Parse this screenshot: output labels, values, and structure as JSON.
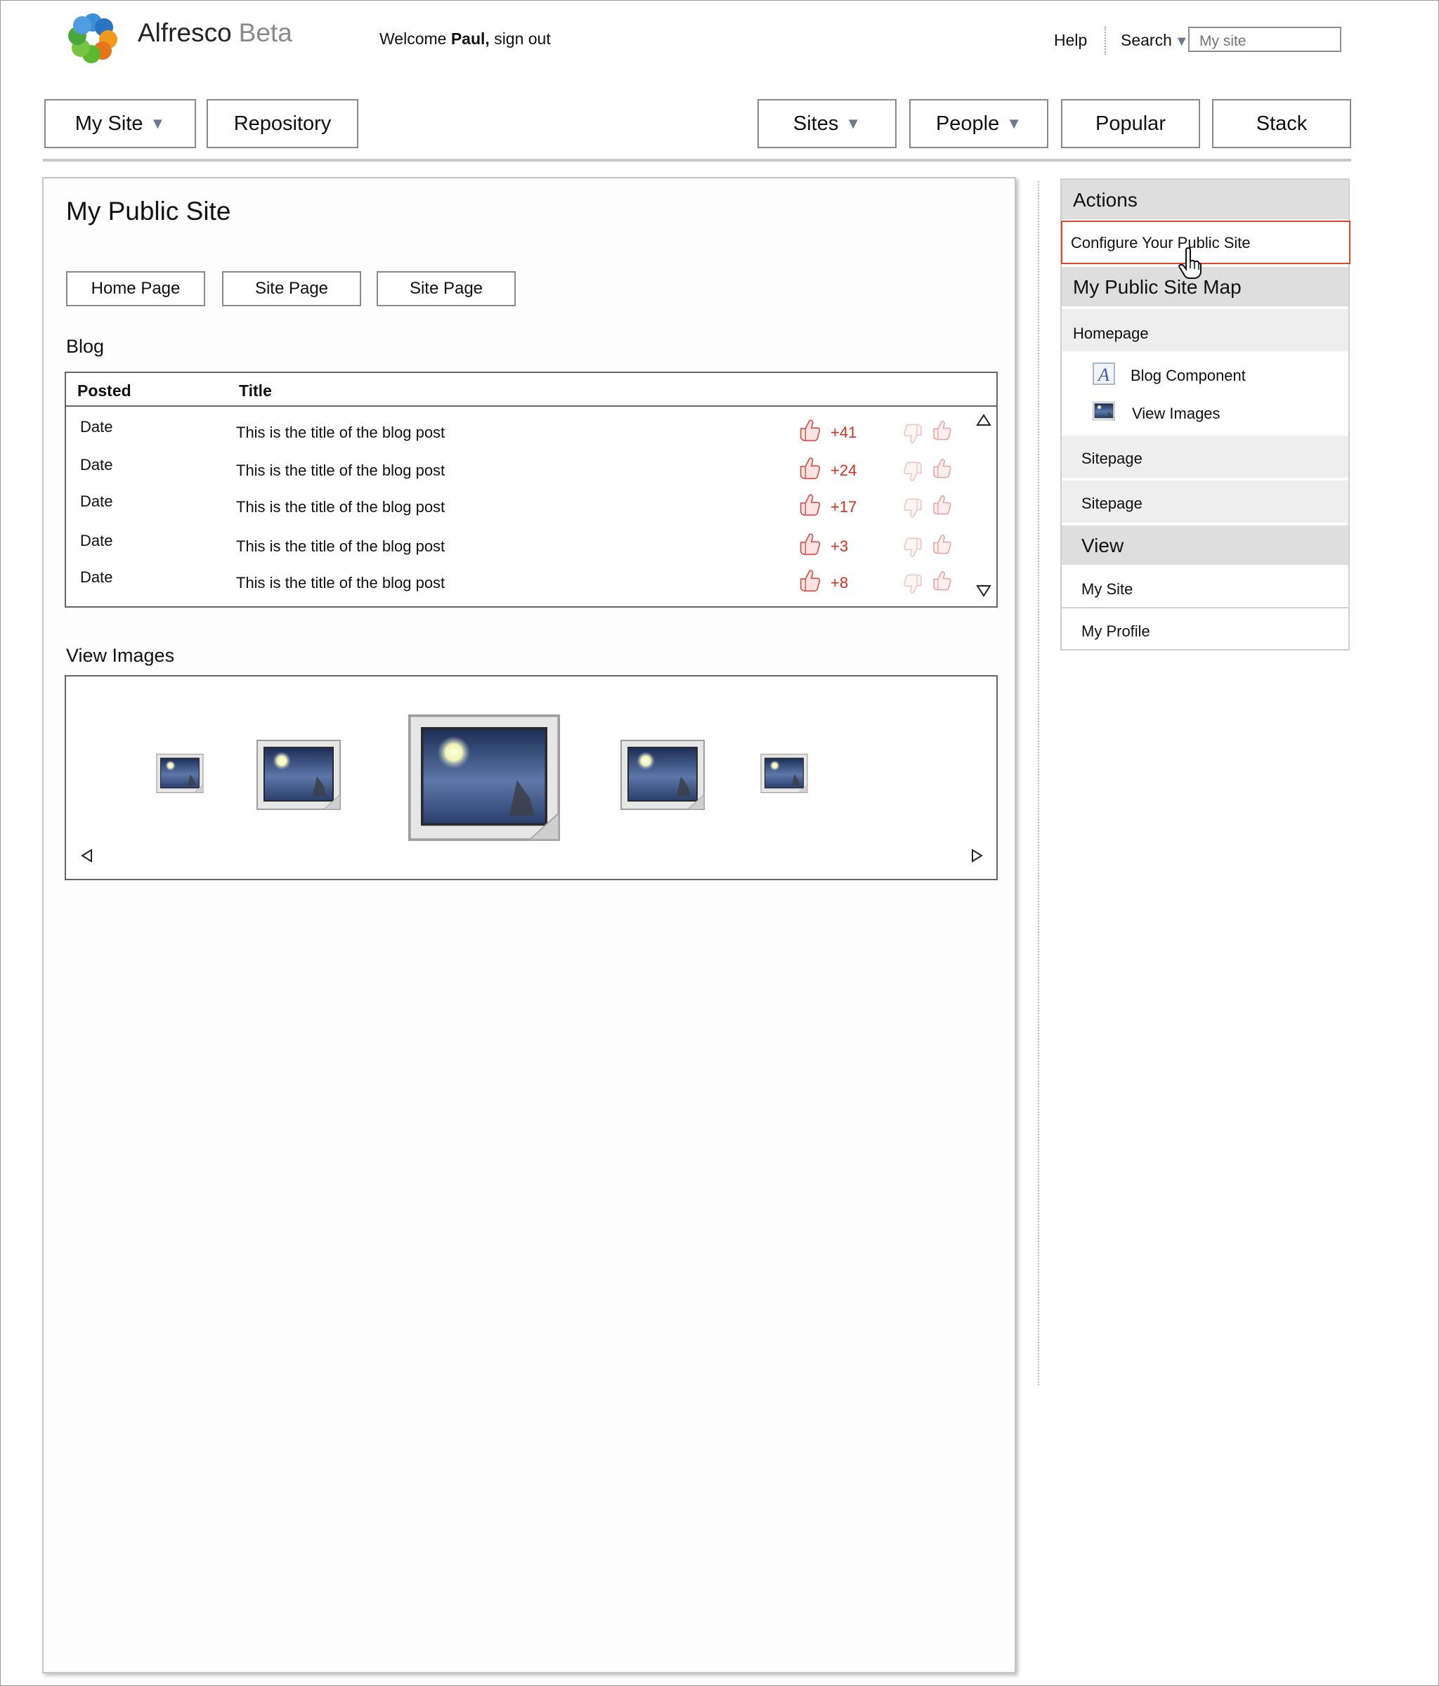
{
  "header": {
    "brand_name": "Alfresco",
    "brand_suffix": "Beta",
    "welcome_prefix": "Welcome",
    "user_name": "Paul,",
    "sign_out": "sign out",
    "help": "Help",
    "search_label": "Search",
    "search_placeholder": "My site"
  },
  "nav": {
    "my_site": "My Site",
    "repository": "Repository",
    "sites": "Sites",
    "people": "People",
    "popular": "Popular",
    "stack": "Stack"
  },
  "main": {
    "title": "My Public Site",
    "page_buttons": [
      "Home Page",
      "Site Page",
      "Site Page"
    ],
    "blog_label": "Blog",
    "blog_columns": [
      "Posted",
      "Title"
    ],
    "blog_rows": [
      {
        "date": "Date",
        "title": "This is the title of the blog post",
        "score": "+41"
      },
      {
        "date": "Date",
        "title": "This is the title of the blog post",
        "score": "+24"
      },
      {
        "date": "Date",
        "title": "This is the title of the blog post",
        "score": "+17"
      },
      {
        "date": "Date",
        "title": "This is the title of the blog post",
        "score": "+3"
      },
      {
        "date": "Date",
        "title": "This is the title of the blog post",
        "score": "+8"
      }
    ],
    "images_label": "View Images"
  },
  "sidebar": {
    "actions_heading": "Actions",
    "configure": "Configure Your Public Site",
    "sitemap_heading": "My Public Site Map",
    "homepage": "Homepage",
    "blog_component": "Blog Component",
    "view_images": "View Images",
    "sitepage_1": "Sitepage",
    "sitepage_2": "Sitepage",
    "view_heading": "View",
    "my_site": "My Site",
    "my_profile": "My Profile"
  },
  "colors": {
    "score_red": "#d0301d",
    "highlight_border": "#d9482b",
    "sidebar_heading_bg": "#dedede",
    "dropdown_arrow": "#6b7a8c"
  },
  "icons": [
    "alfresco-logo-icon",
    "thumbs-up-icon",
    "thumbs-down-icon",
    "scroll-up-icon",
    "scroll-down-icon",
    "image-thumbnail-icon",
    "prev-arrow-icon",
    "next-arrow-icon",
    "blog-component-icon",
    "view-images-icon",
    "hand-cursor-icon"
  ]
}
